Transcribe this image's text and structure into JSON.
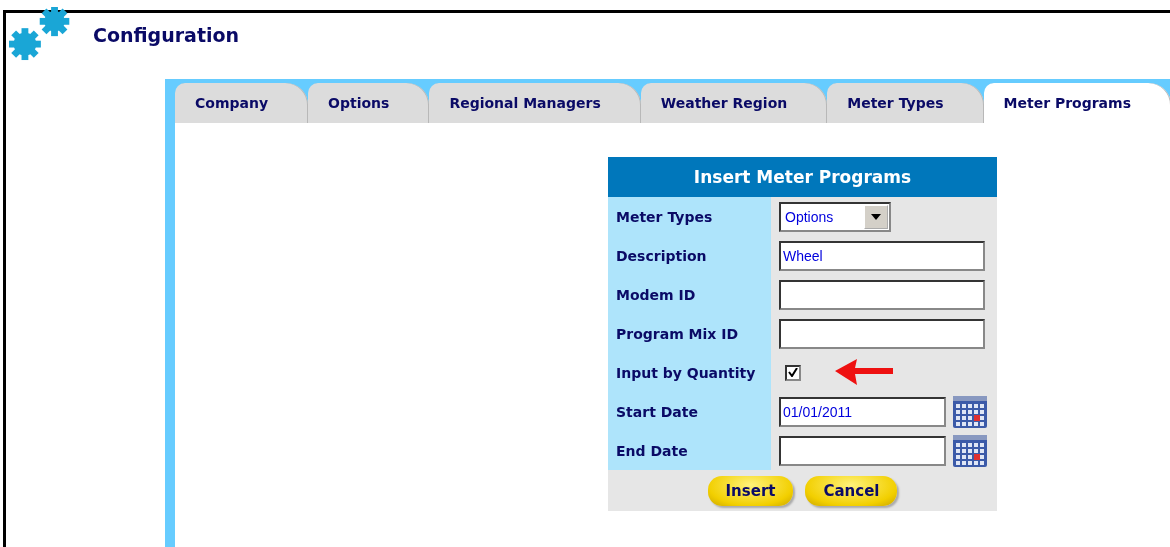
{
  "header": {
    "title": "Configuration"
  },
  "tabs": [
    {
      "label": "Company",
      "selected": false
    },
    {
      "label": "Options",
      "selected": false
    },
    {
      "label": "Regional Managers",
      "selected": false
    },
    {
      "label": "Weather Region",
      "selected": false
    },
    {
      "label": "Meter Types",
      "selected": false
    },
    {
      "label": "Meter Programs",
      "selected": true
    }
  ],
  "form": {
    "title": "Insert Meter Programs",
    "fields": [
      {
        "kind": "select",
        "label": "Meter Types",
        "value": "Options"
      },
      {
        "kind": "text",
        "label": "Description",
        "value": "Wheel"
      },
      {
        "kind": "text",
        "label": "Modem ID"
      },
      {
        "kind": "text",
        "label": "Program Mix ID"
      },
      {
        "kind": "checkbox",
        "label": "Input by Quantity",
        "checked": true
      },
      {
        "kind": "date",
        "label": "Start Date",
        "value": "01/01/2011"
      },
      {
        "kind": "date",
        "label": "End Date"
      }
    ],
    "buttons": [
      "Insert",
      "Cancel"
    ]
  }
}
